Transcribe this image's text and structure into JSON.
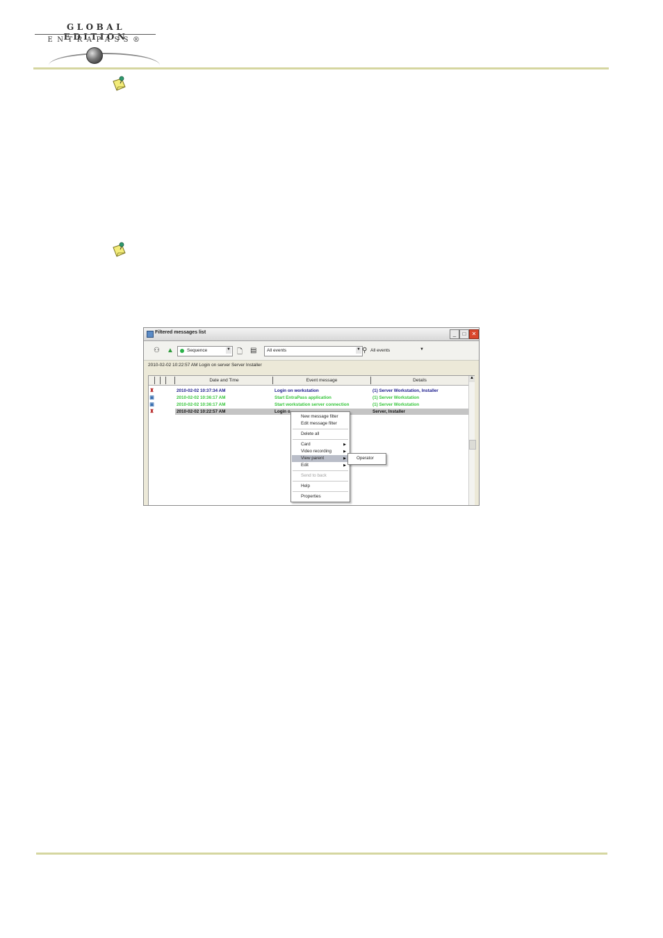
{
  "header": {
    "logo_line1": "GLOBAL EDITION",
    "logo_line2": "ENTRAPASS®"
  },
  "notes": [
    {
      "icon": "note-pin-icon"
    },
    {
      "icon": "note-pin-icon"
    }
  ],
  "window": {
    "title": "Filtered messages list",
    "toolbar": {
      "sort_combo": "Sequence",
      "filter_combo": "All events",
      "events_combo": "All events"
    },
    "info_line": "2010-02-02 10:22:57 AM  Login on server  Server  Installer",
    "columns": [
      "Date and Time",
      "Event message",
      "Details"
    ],
    "rows": [
      {
        "date": "2010-02-02 10:37:34 AM",
        "event": "Login on workstation",
        "details": "(1)  Server Workstation, Installer",
        "color": "#1a1a8c"
      },
      {
        "date": "2010-02-02 10:36:17 AM",
        "event": "Start EntraPass application",
        "details": "(1)  Server Workstation",
        "color": "#35c53a"
      },
      {
        "date": "2010-02-02 10:36:17 AM",
        "event": "Start workstation server connection",
        "details": "(1)  Server Workstation",
        "color": "#35c53a"
      },
      {
        "date": "2010-02-02 10:22:57 AM",
        "event": "Login o",
        "details": "Server, Installer",
        "color": "#111111"
      }
    ],
    "context_menu": [
      {
        "label": "New message filter"
      },
      {
        "label": "Edit message filter"
      },
      {
        "label": "Delete all"
      },
      {
        "label": "Card",
        "submenu": true
      },
      {
        "label": "Video recording",
        "submenu": true
      },
      {
        "label": "View parent",
        "submenu": true
      },
      {
        "label": "Edit",
        "submenu": true
      },
      {
        "label": "Send to back",
        "disabled": true
      },
      {
        "label": "Help"
      },
      {
        "label": "Properties"
      }
    ],
    "submenu_item": "Operator"
  }
}
